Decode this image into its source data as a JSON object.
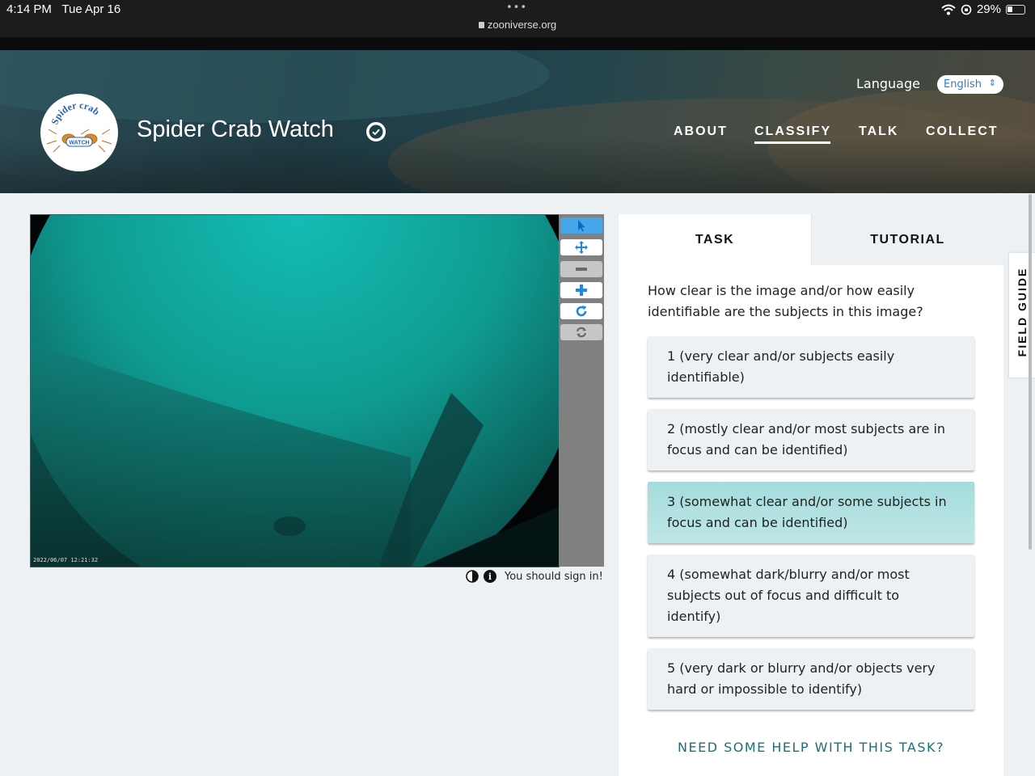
{
  "status_bar": {
    "time": "4:14 PM",
    "date": "Tue Apr 16",
    "dots": "•••",
    "url": "zooniverse.org",
    "battery": "29%",
    "battery_level": 0.29
  },
  "header": {
    "project_title": "Spider Crab Watch",
    "logo_top_text": "Spider crab",
    "logo_bottom_text": "WATCH",
    "language_label": "Language",
    "language_value": "English",
    "nav": [
      {
        "label": "ABOUT",
        "active": false
      },
      {
        "label": "CLASSIFY",
        "active": true
      },
      {
        "label": "TALK",
        "active": false
      },
      {
        "label": "COLLECT",
        "active": false
      }
    ]
  },
  "viewer": {
    "timestamp": "2022/06/07 12:21:32",
    "tools": [
      "pointer-icon",
      "pan-icon",
      "zoom-out-icon",
      "zoom-in-icon",
      "rotate-icon",
      "reset-icon"
    ],
    "sign_in_text": "You should sign in!"
  },
  "task_panel": {
    "tabs": [
      "TASK",
      "TUTORIAL"
    ],
    "question": "How clear is the image and/or how easily identifiable are the subjects in this image?",
    "answers": [
      {
        "label": "1 (very clear and/or subjects easily identifiable)",
        "selected": false
      },
      {
        "label": "2 (mostly clear and/or most subjects are in focus and can be identified)",
        "selected": false
      },
      {
        "label": "3 (somewhat clear and/or some subjects in focus and can be identified)",
        "selected": true
      },
      {
        "label": "4 (somewhat dark/blurry and/or most subjects out of focus and difficult to identify)",
        "selected": false
      },
      {
        "label": "5 (very dark or blurry and/or objects very hard or impossible to identify)",
        "selected": false
      }
    ],
    "help_link": "NEED SOME HELP WITH THIS TASK?"
  },
  "field_guide": {
    "label": "FIELD GUIDE"
  },
  "colors": {
    "accent_blue": "#46a6ea",
    "selected_answer": "#a4dcdc",
    "help_link": "#1d6f78",
    "page_bg": "#eef1f4"
  }
}
